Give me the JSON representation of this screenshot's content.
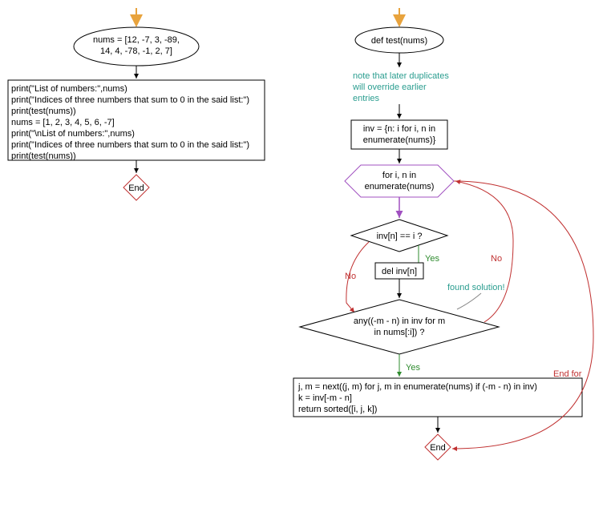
{
  "left": {
    "start_node": "nums = [12, -7, 3, -89,\n14, 4, -78, -1, 2, 7]",
    "code_block": "print(\"List of numbers:\",nums)\nprint(\"Indices of three numbers that sum to 0 in the said list:\")\nprint(test(nums))\nnums = [1, 2, 3, 4, 5, 6, -7]\nprint(\"\\nList of numbers:\",nums)\nprint(\"Indices of three numbers that sum to 0 in the said list:\")\nprint(test(nums))",
    "end": "End"
  },
  "right": {
    "def_node": "def test(nums)",
    "comment": "note that later duplicates\nwill override earlier\nentries",
    "inv_node": "inv = {n: i for i, n in\nenumerate(nums)}",
    "for_node": "for i, n in\nenumerate(nums)",
    "cond1": "inv[n] == i ?",
    "del_node": "del inv[n]",
    "found_comment": "found solution!",
    "cond2": "any((-m - n) in inv for m\nin nums[:i]) ?",
    "result_block": "j, m = next((j, m) for j, m in enumerate(nums) if (-m - n) in inv)\nk = inv[-m - n]\nreturn sorted([i, j, k])",
    "end": "End",
    "yes": "Yes",
    "no": "No",
    "end_for": "End for"
  }
}
